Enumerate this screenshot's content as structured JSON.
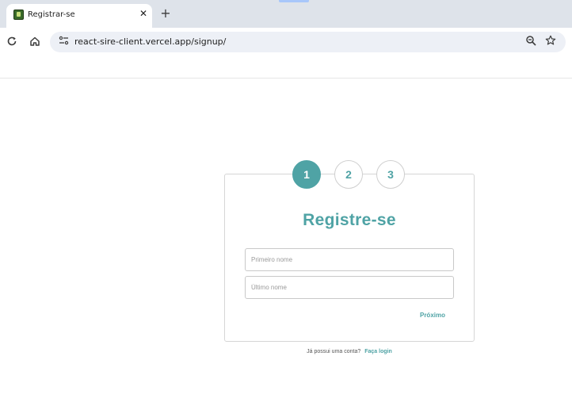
{
  "browser": {
    "tab_title": "Registrar-se",
    "tab_close": "✕",
    "new_tab": "+",
    "url": "react-sire-client.vercel.app/signup/"
  },
  "icons": {
    "favicon": "favicon-icon",
    "reload": "reload-icon",
    "home": "home-icon",
    "site_info": "site-info-icon",
    "zoom": "zoom-icon",
    "bookmark": "star-icon"
  },
  "steps": [
    "1",
    "2",
    "3"
  ],
  "active_step": "1",
  "form": {
    "title": "Registre-se",
    "first_name_placeholder": "Primeiro nome",
    "last_name_placeholder": "Último nome",
    "next_label": "Próximo"
  },
  "footer": {
    "question": "Já possui uma conta?",
    "login_link": "Faça login"
  },
  "colors": {
    "accent": "#4fa3a5",
    "border": "#d6d6d6"
  }
}
